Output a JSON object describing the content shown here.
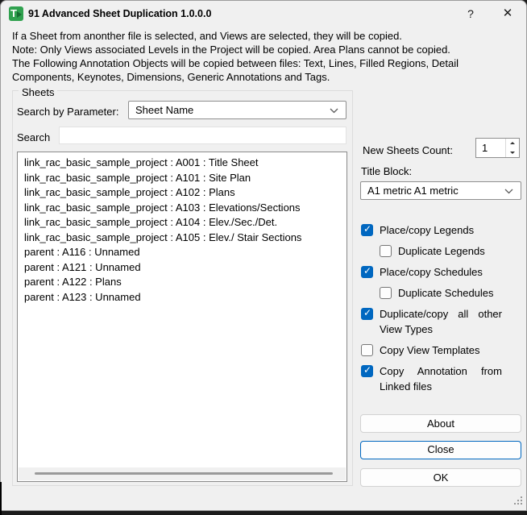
{
  "window": {
    "title": "91 Advanced Sheet Duplication 1.0.0.0",
    "help_glyph": "?",
    "close_glyph": "✕",
    "icon_letter": "T"
  },
  "intro_lines": [
    "If a Sheet from anonther file is selected, and Views are selected, they will be copied.",
    "Note: Only Views associated Levels in the Project will be copied. Area Plans cannot be copied.",
    "The Following Annotation Objects will be copied between files: Text, Lines, Filled Regions, Detail",
    "Components, Keynotes, Dimensions, Generic Annotations and Tags."
  ],
  "sheets_group": {
    "label": "Sheets",
    "search_by_parameter_label": "Search by Parameter:",
    "parameter_value": "Sheet Name",
    "search_label": "Search",
    "search_value": "",
    "items": [
      "link_rac_basic_sample_project : A001 : Title Sheet",
      "link_rac_basic_sample_project : A101 : Site Plan",
      "link_rac_basic_sample_project : A102 : Plans",
      "link_rac_basic_sample_project : A103 : Elevations/Sections",
      "link_rac_basic_sample_project : A104 : Elev./Sec./Det.",
      "link_rac_basic_sample_project : A105 : Elev./ Stair Sections",
      "parent : A116 : Unnamed",
      "parent : A121 : Unnamed",
      "parent : A122 : Plans",
      "parent : A123 : Unnamed"
    ]
  },
  "right_panel": {
    "new_sheets_count_label": "New Sheets Count:",
    "new_sheets_count_value": "1",
    "title_block_label": "Title Block:",
    "title_block_value": "A1 metric A1 metric",
    "checkboxes": [
      {
        "lines": [
          "Place/copy Legends"
        ],
        "checked": true,
        "indent": false
      },
      {
        "lines": [
          "Duplicate Legends"
        ],
        "checked": false,
        "indent": true
      },
      {
        "lines": [
          "Place/copy Schedules"
        ],
        "checked": true,
        "indent": false
      },
      {
        "lines": [
          "Duplicate Schedules"
        ],
        "checked": false,
        "indent": true
      },
      {
        "lines": [
          "Duplicate/copy all other",
          "View Types"
        ],
        "checked": true,
        "indent": false
      },
      {
        "lines": [
          "Copy View Templates"
        ],
        "checked": false,
        "indent": false
      },
      {
        "lines": [
          "Copy Annotation from",
          "Linked files"
        ],
        "checked": true,
        "indent": false
      }
    ],
    "buttons": {
      "about": "About",
      "close": "Close",
      "ok": "OK"
    }
  },
  "colors": {
    "accent": "#0067c0",
    "dialog_bg": "#f0f0f0"
  }
}
